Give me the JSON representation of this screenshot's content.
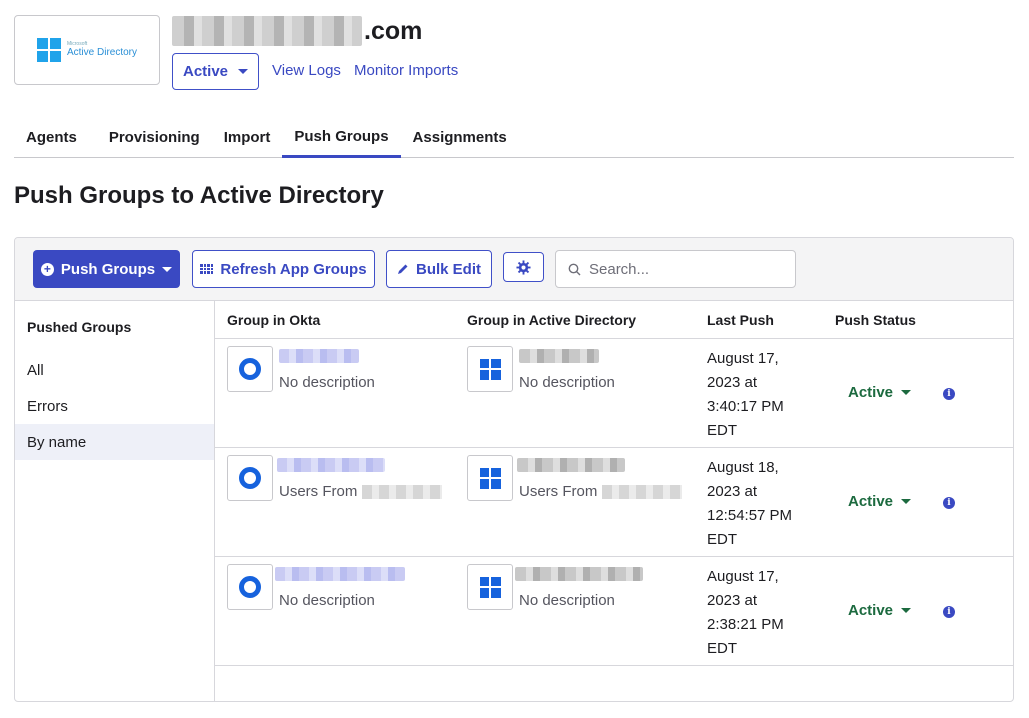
{
  "header": {
    "logo_small": "Microsoft",
    "logo_text": "Active Directory",
    "app_domain_suffix": ".com",
    "status": "Active",
    "links": [
      "View Logs",
      "Monitor Imports"
    ]
  },
  "tabs": [
    {
      "label": "Agents"
    },
    {
      "label": "Provisioning"
    },
    {
      "label": "Import"
    },
    {
      "label": "Push Groups",
      "active": true
    },
    {
      "label": "Assignments"
    }
  ],
  "page_title": "Push Groups to Active Directory",
  "toolbar": {
    "push_groups": "Push Groups",
    "refresh": "Refresh App Groups",
    "bulk_edit": "Bulk Edit",
    "search_placeholder": "Search..."
  },
  "sidebar": {
    "heading": "Pushed Groups",
    "items": [
      {
        "label": "All"
      },
      {
        "label": "Errors"
      },
      {
        "label": "By name",
        "selected": true
      }
    ]
  },
  "table": {
    "columns": [
      "Group in Okta",
      "Group in Active Directory",
      "Last Push",
      "Push Status"
    ],
    "rows": [
      {
        "okta_desc": "No description",
        "ad_desc": "No description",
        "last_push": "August 17, 2023 at 3:40:17 PM EDT",
        "status": "Active"
      },
      {
        "okta_desc": "Users From",
        "ad_desc": "Users From",
        "last_push": "August 18, 2023 at 12:54:57 PM EDT",
        "status": "Active"
      },
      {
        "okta_desc": "No description",
        "ad_desc": "No description",
        "last_push": "August 17, 2023 at 2:38:21 PM EDT",
        "status": "Active"
      }
    ]
  },
  "colors": {
    "accent": "#3a49c2",
    "status_active": "#1c6a3f",
    "icon_blue": "#1662dd"
  }
}
